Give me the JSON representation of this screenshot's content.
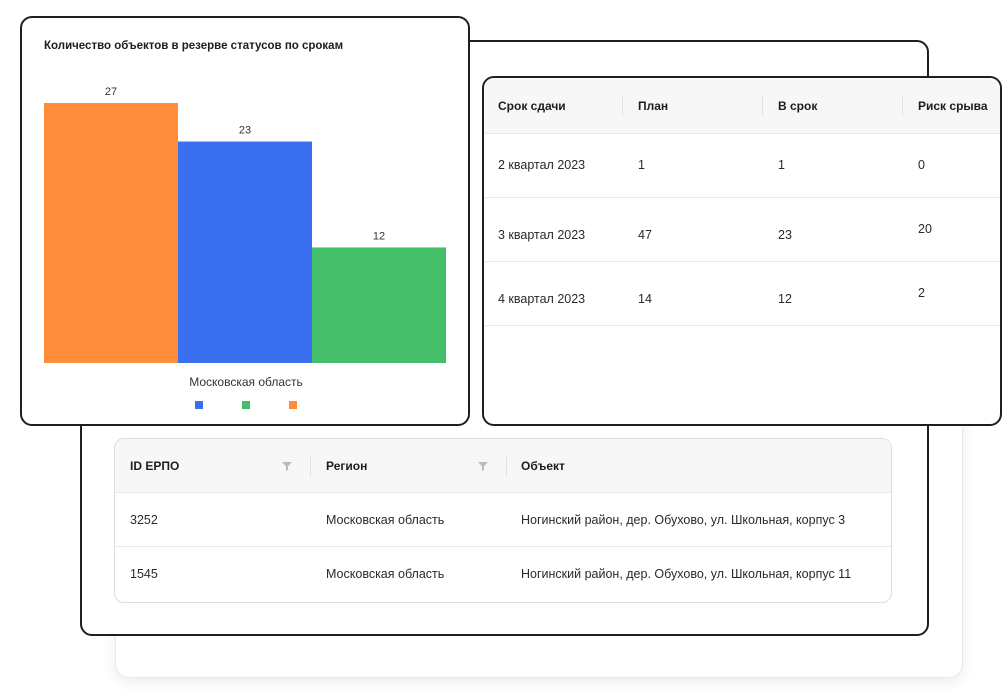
{
  "chart_card": {
    "title": "Количество объектов в резерве статусов по срокам"
  },
  "chart_data": {
    "type": "bar",
    "categories": [
      "Московская область"
    ],
    "series": [
      {
        "values": [
          27
        ],
        "color": "#FF8C3B"
      },
      {
        "values": [
          23
        ],
        "color": "#3A6FF0"
      },
      {
        "values": [
          12
        ],
        "color": "#45BE6A"
      }
    ],
    "legend_colors": [
      "#3A6FF0",
      "#45BE6A",
      "#FF8C3B"
    ],
    "xlabel": "Московская область",
    "ylim": [
      0,
      27
    ]
  },
  "quarters_table": {
    "headers": [
      "Срок сдачи",
      "План",
      "В срок",
      "Риск срыва"
    ],
    "rows": [
      [
        "2 квартал 2023",
        "1",
        "1",
        "0"
      ],
      [
        "3 квартал 2023",
        "47",
        "23",
        "20"
      ],
      [
        "4 квартал 2023",
        "14",
        "12",
        "2"
      ]
    ]
  },
  "objects_table": {
    "headers": [
      "ID ЕРПО",
      "Регион",
      "Объект"
    ],
    "filter_icons": [
      "filter-icon",
      "filter-icon"
    ],
    "rows": [
      [
        "3252",
        "Московская область",
        "Ногинский район, дер. Обухово, ул. Школьная, корпус 3"
      ],
      [
        "1545",
        "Московская область",
        "Ногинский район, дер. Обухово, ул. Школьная, корпус 11"
      ]
    ]
  }
}
